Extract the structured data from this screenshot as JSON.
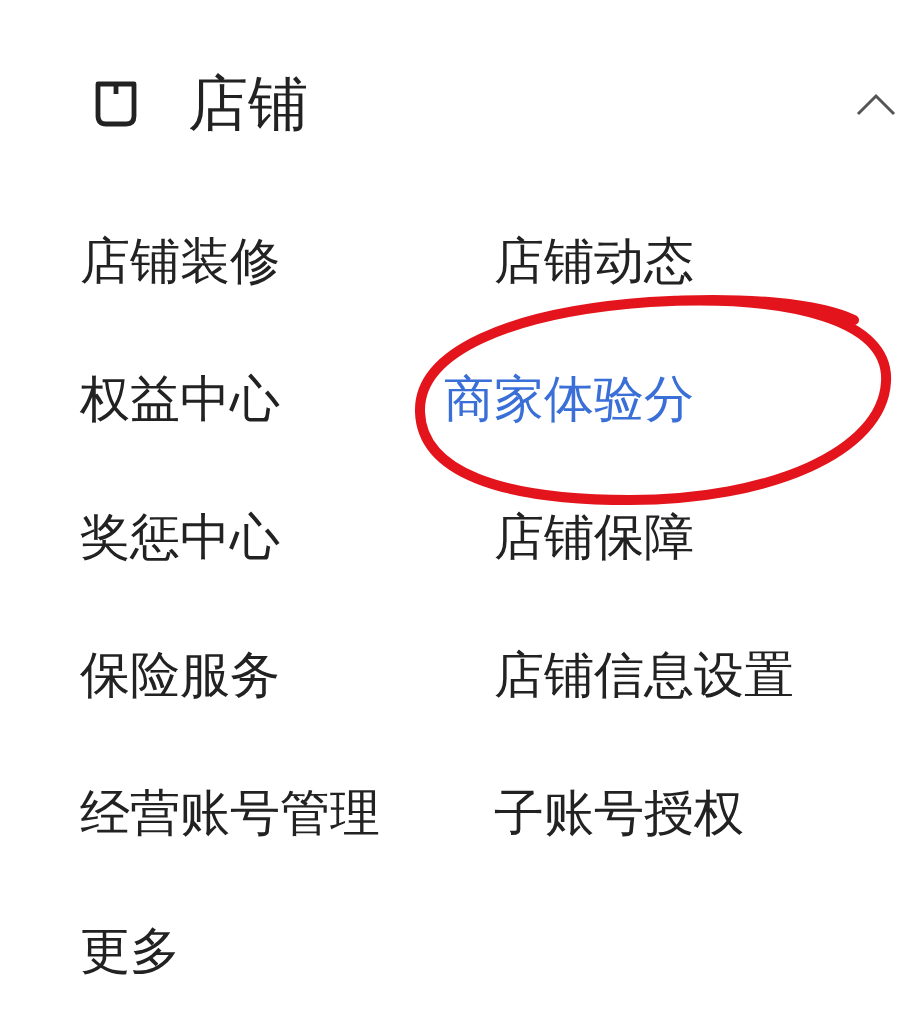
{
  "header": {
    "title": "店铺",
    "expanded": true
  },
  "items": [
    {
      "label": "店铺装修",
      "selected": false
    },
    {
      "label": "店铺动态",
      "selected": false
    },
    {
      "label": "权益中心",
      "selected": false
    },
    {
      "label": "商家体验分",
      "selected": true
    },
    {
      "label": "奖惩中心",
      "selected": false
    },
    {
      "label": "店铺保障",
      "selected": false
    },
    {
      "label": "保险服务",
      "selected": false
    },
    {
      "label": "店铺信息设置",
      "selected": false
    },
    {
      "label": "经营账号管理",
      "selected": false
    },
    {
      "label": "子账号授权",
      "selected": false
    },
    {
      "label": "更多",
      "selected": false
    }
  ],
  "annotation": {
    "kind": "ellipse",
    "color": "#e3141b"
  }
}
